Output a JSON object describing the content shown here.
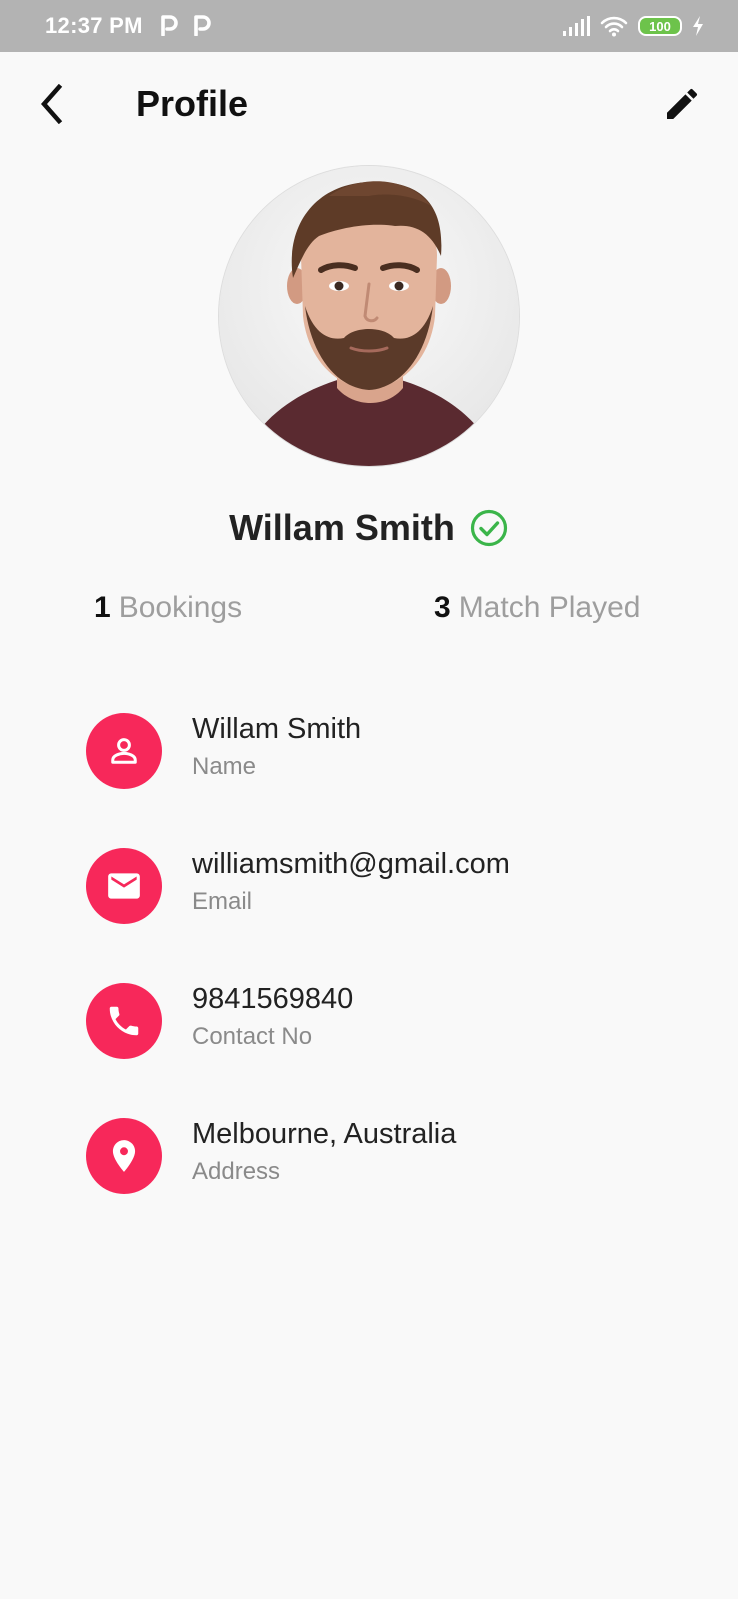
{
  "status_bar": {
    "time": "12:37 PM",
    "battery": "100",
    "icons": [
      "parking-app-icon",
      "parking-app-icon",
      "signal-icon",
      "wifi-icon",
      "battery-icon",
      "charging-icon"
    ]
  },
  "header": {
    "title": "Profile",
    "back_icon": "chevron-left-icon",
    "edit_icon": "pencil-icon"
  },
  "profile": {
    "name": "Willam Smith",
    "verified_icon": "check-circle-icon",
    "verified_color": "#3bb54a"
  },
  "stats": [
    {
      "count": "1",
      "label": "Bookings"
    },
    {
      "count": "3",
      "label": "Match Played"
    }
  ],
  "details": [
    {
      "value": "Willam Smith",
      "label": "Name",
      "icon": "person-icon"
    },
    {
      "value": "williamsmith@gmail.com",
      "label": "Email",
      "icon": "mail-icon"
    },
    {
      "value": "9841569840",
      "label": "Contact No",
      "icon": "phone-icon"
    },
    {
      "value": "Melbourne, Australia",
      "label": "Address",
      "icon": "location-pin-icon"
    }
  ],
  "colors": {
    "accent": "#f7285a",
    "status_bar": "#b3b3b3",
    "background": "#f9f9f9",
    "battery": "#6dc34b"
  }
}
